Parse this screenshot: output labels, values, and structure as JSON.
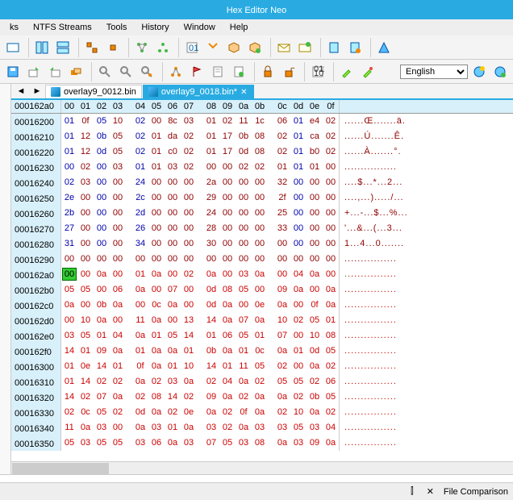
{
  "title": "Hex Editor Neo",
  "menu": [
    "ks",
    "NTFS Streams",
    "Tools",
    "History",
    "Window",
    "Help"
  ],
  "language": "English",
  "tabs": [
    {
      "label": "overlay9_0012.bin",
      "active": false,
      "dirty": false
    },
    {
      "label": "overlay9_0018.bin*",
      "active": true,
      "dirty": true
    }
  ],
  "columns": [
    "00",
    "01",
    "02",
    "03",
    "04",
    "05",
    "06",
    "07",
    "08",
    "09",
    "0a",
    "0b",
    "0c",
    "0d",
    "0e",
    "0f"
  ],
  "selected_addr": "000162a0",
  "selected_byte": "00",
  "rows": [
    {
      "addr": "00016200",
      "bytes": [
        "01",
        "0f",
        "05",
        "10",
        "02",
        "00",
        "8c",
        "03",
        "01",
        "02",
        "11",
        "1c",
        "06",
        "01",
        "e4",
        "02"
      ],
      "blue": [
        0,
        2,
        4,
        13
      ],
      "ascii": "......Œ.......ä."
    },
    {
      "addr": "00016210",
      "bytes": [
        "01",
        "12",
        "0b",
        "05",
        "02",
        "01",
        "da",
        "02",
        "01",
        "17",
        "0b",
        "08",
        "02",
        "01",
        "ca",
        "02"
      ],
      "blue": [
        0,
        2,
        4,
        13
      ],
      "ascii": "......Ú.......Ê."
    },
    {
      "addr": "00016220",
      "bytes": [
        "01",
        "12",
        "0d",
        "05",
        "02",
        "01",
        "c0",
        "02",
        "01",
        "17",
        "0d",
        "08",
        "02",
        "01",
        "b0",
        "02"
      ],
      "blue": [
        0,
        2,
        4,
        13
      ],
      "ascii": "......À.......°."
    },
    {
      "addr": "00016230",
      "bytes": [
        "00",
        "02",
        "00",
        "03",
        "01",
        "01",
        "03",
        "02",
        "00",
        "00",
        "02",
        "02",
        "01",
        "01",
        "01",
        "00"
      ],
      "blue": [
        0,
        2,
        4,
        13
      ],
      "ascii": "................"
    },
    {
      "addr": "00016240",
      "bytes": [
        "02",
        "03",
        "00",
        "00",
        "24",
        "00",
        "00",
        "00",
        "2a",
        "00",
        "00",
        "00",
        "32",
        "00",
        "00",
        "00"
      ],
      "blue": [
        0,
        2,
        4,
        13
      ],
      "ascii": "....$...*...2..."
    },
    {
      "addr": "00016250",
      "bytes": [
        "2e",
        "00",
        "00",
        "00",
        "2c",
        "00",
        "00",
        "00",
        "29",
        "00",
        "00",
        "00",
        "2f",
        "00",
        "00",
        "00"
      ],
      "blue": [
        0,
        2,
        4,
        13
      ],
      "ascii": "....,...)...../..."
    },
    {
      "addr": "00016260",
      "bytes": [
        "2b",
        "00",
        "00",
        "00",
        "2d",
        "00",
        "00",
        "00",
        "24",
        "00",
        "00",
        "00",
        "25",
        "00",
        "00",
        "00"
      ],
      "blue": [
        0,
        2,
        4,
        13
      ],
      "ascii": "+...-...$...%..."
    },
    {
      "addr": "00016270",
      "bytes": [
        "27",
        "00",
        "00",
        "00",
        "26",
        "00",
        "00",
        "00",
        "28",
        "00",
        "00",
        "00",
        "33",
        "00",
        "00",
        "00"
      ],
      "blue": [
        0,
        2,
        4,
        13
      ],
      "ascii": "'...&...(...3..."
    },
    {
      "addr": "00016280",
      "bytes": [
        "31",
        "00",
        "00",
        "00",
        "34",
        "00",
        "00",
        "00",
        "30",
        "00",
        "00",
        "00",
        "00",
        "00",
        "00",
        "00"
      ],
      "blue": [
        0,
        2,
        4,
        13
      ],
      "ascii": "1...4...0......."
    },
    {
      "addr": "00016290",
      "bytes": [
        "00",
        "00",
        "00",
        "00",
        "00",
        "00",
        "00",
        "00",
        "00",
        "00",
        "00",
        "00",
        "00",
        "00",
        "00",
        "00"
      ],
      "blue": [],
      "ascii": "................"
    },
    {
      "addr": "000162a0",
      "bytes": [
        "00",
        "00",
        "0a",
        "00",
        "01",
        "0a",
        "00",
        "02",
        "0a",
        "00",
        "03",
        "0a",
        "00",
        "04",
        "0a",
        "00"
      ],
      "blue": [],
      "sel": 0,
      "red": true,
      "ascii": "................",
      "asciiGr": "."
    },
    {
      "addr": "000162b0",
      "bytes": [
        "05",
        "05",
        "00",
        "06",
        "0a",
        "00",
        "07",
        "00",
        "0d",
        "08",
        "05",
        "00",
        "09",
        "0a",
        "00",
        "0a"
      ],
      "blue": [],
      "red": true,
      "ascii": "................"
    },
    {
      "addr": "000162c0",
      "bytes": [
        "0a",
        "00",
        "0b",
        "0a",
        "00",
        "0c",
        "0a",
        "00",
        "0d",
        "0a",
        "00",
        "0e",
        "0a",
        "00",
        "0f",
        "0a"
      ],
      "blue": [],
      "red": true,
      "ascii": "................"
    },
    {
      "addr": "000162d0",
      "bytes": [
        "00",
        "10",
        "0a",
        "00",
        "11",
        "0a",
        "00",
        "13",
        "14",
        "0a",
        "07",
        "0a",
        "10",
        "02",
        "05",
        "01"
      ],
      "blue": [],
      "red": true,
      "ascii": "................"
    },
    {
      "addr": "000162e0",
      "bytes": [
        "03",
        "05",
        "01",
        "04",
        "0a",
        "01",
        "05",
        "14",
        "01",
        "06",
        "05",
        "01",
        "07",
        "00",
        "10",
        "08"
      ],
      "blue": [],
      "red": true,
      "ascii": "................"
    },
    {
      "addr": "000162f0",
      "bytes": [
        "14",
        "01",
        "09",
        "0a",
        "01",
        "0a",
        "0a",
        "01",
        "0b",
        "0a",
        "01",
        "0c",
        "0a",
        "01",
        "0d",
        "05"
      ],
      "blue": [],
      "red": true,
      "ascii": "................"
    },
    {
      "addr": "00016300",
      "bytes": [
        "01",
        "0e",
        "14",
        "01",
        "0f",
        "0a",
        "01",
        "10",
        "14",
        "01",
        "11",
        "05",
        "02",
        "00",
        "0a",
        "02"
      ],
      "blue": [],
      "red": true,
      "ascii": "................"
    },
    {
      "addr": "00016310",
      "bytes": [
        "01",
        "14",
        "02",
        "02",
        "0a",
        "02",
        "03",
        "0a",
        "02",
        "04",
        "0a",
        "02",
        "05",
        "05",
        "02",
        "06"
      ],
      "blue": [],
      "red": true,
      "ascii": "................"
    },
    {
      "addr": "00016320",
      "bytes": [
        "14",
        "02",
        "07",
        "0a",
        "02",
        "08",
        "14",
        "02",
        "09",
        "0a",
        "02",
        "0a",
        "0a",
        "02",
        "0b",
        "05"
      ],
      "blue": [],
      "red": true,
      "ascii": "................"
    },
    {
      "addr": "00016330",
      "bytes": [
        "02",
        "0c",
        "05",
        "02",
        "0d",
        "0a",
        "02",
        "0e",
        "0a",
        "02",
        "0f",
        "0a",
        "02",
        "10",
        "0a",
        "02"
      ],
      "blue": [],
      "red": true,
      "ascii": "................"
    },
    {
      "addr": "00016340",
      "bytes": [
        "11",
        "0a",
        "03",
        "00",
        "0a",
        "03",
        "01",
        "0a",
        "03",
        "02",
        "0a",
        "03",
        "03",
        "05",
        "03",
        "04"
      ],
      "blue": [],
      "red": true,
      "ascii": "................"
    },
    {
      "addr": "00016350",
      "bytes": [
        "05",
        "03",
        "05",
        "05",
        "03",
        "06",
        "0a",
        "03",
        "07",
        "05",
        "03",
        "08",
        "0a",
        "03",
        "09",
        "0a"
      ],
      "blue": [],
      "red": true,
      "ascii": "................"
    }
  ],
  "status": {
    "pin": "⫿",
    "close": "✕",
    "label": "File Comparison"
  }
}
